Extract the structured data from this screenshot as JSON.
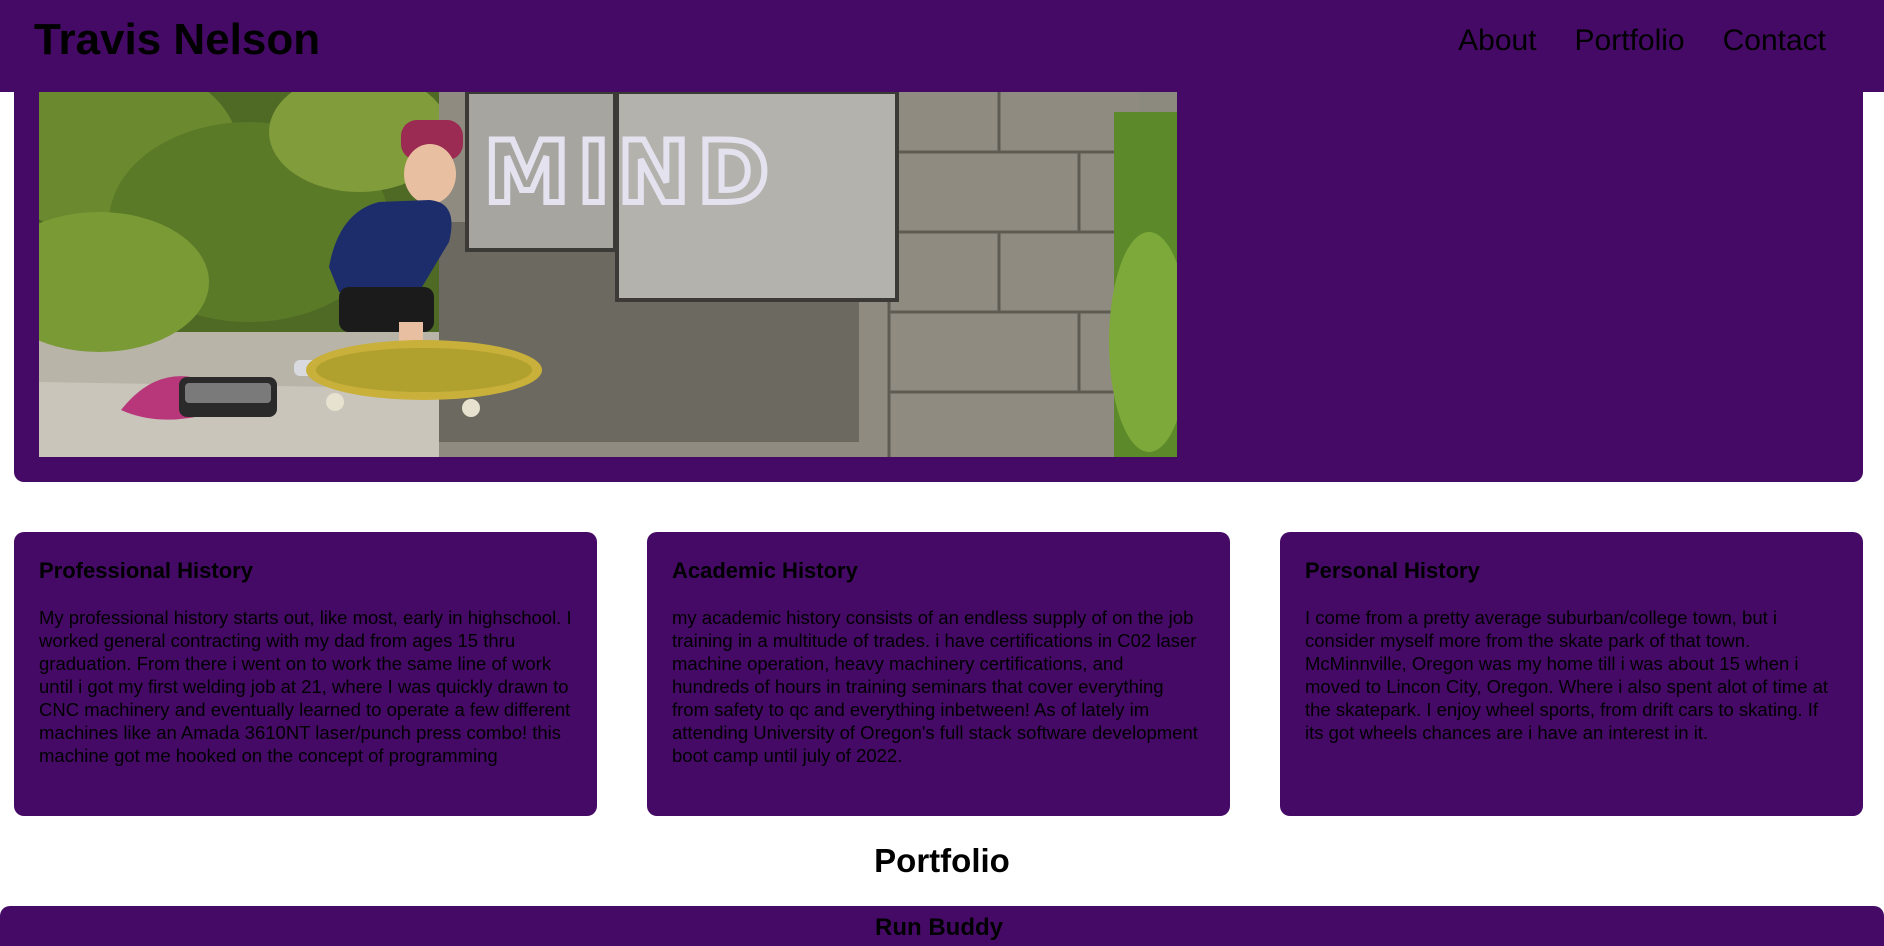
{
  "header": {
    "title": "Travis Nelson",
    "nav": [
      "About",
      "Portfolio",
      "Contact"
    ]
  },
  "hero": {
    "image": "photo-of-skateboarder",
    "graffiti_text": "MIND"
  },
  "cards": [
    {
      "title": "Professional History",
      "text": "My professional history starts out, like most, early in highschool. I worked general contracting with my dad from ages 15 thru graduation. From there i went on to work the same line of work until i got my first welding job at 21, where I was quickly drawn to CNC machinery and eventually learned to operate a few different machines like an Amada 3610NT laser/punch press combo! this machine got me hooked on the concept of programming"
    },
    {
      "title": "Academic History",
      "text": "my academic history consists of an endless supply of on the job training in a multitude of trades. i have certifications in C02 laser machine operation, heavy machinery certifications, and hundreds of hours in training seminars that cover everything from safety to qc and everything inbetween! As of lately im attending University of Oregon's full stack software development boot camp until july of 2022."
    },
    {
      "title": "Personal History",
      "text": "I come from a pretty average suburban/college town, but i consider myself more from the skate park of that town. McMinnville, Oregon was my home till i was about 15 when i moved to Lincon City, Oregon. Where i also spent alot of time at the skatepark. I enjoy wheel sports, from drift cars to skating. If its got wheels chances are i have an interest in it."
    }
  ],
  "portfolio": {
    "heading": "Portfolio",
    "first_project": "Run Buddy"
  },
  "colors": {
    "accent": "#450a66"
  }
}
